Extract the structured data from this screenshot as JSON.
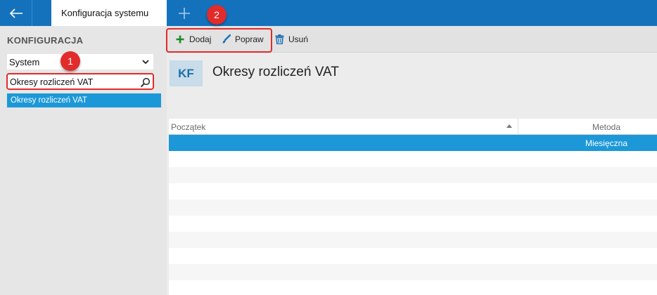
{
  "titlebar": {
    "active_tab_label": "Konfiguracja systemu"
  },
  "sidebar": {
    "heading": "KONFIGURACJA",
    "section_select_value": "System",
    "search_value": "Okresy rozliczeń VAT",
    "results": [
      "Okresy rozliczeń VAT"
    ]
  },
  "toolbar": {
    "add_label": "Dodaj",
    "edit_label": "Popraw",
    "delete_label": "Usuń"
  },
  "main": {
    "badge": "KF",
    "title": "Okresy rozliczeń VAT",
    "grid": {
      "columns": [
        "Początek",
        "Metoda"
      ],
      "rows": [
        {
          "start": "",
          "method": "Miesięczna"
        }
      ]
    }
  },
  "annotations": {
    "callout_1": "1",
    "callout_2": "2"
  },
  "colors": {
    "titlebar": "#1472bd",
    "selection": "#1c98d8",
    "add_icon": "#1e8a23",
    "edit_icon": "#1c6fb5",
    "delete_icon": "#1c6fb5",
    "annotation": "#e22b2b"
  },
  "icons": {
    "back": "arrow-left-icon",
    "new_tab": "plus-icon",
    "dropdown": "chevron-down-icon",
    "search": "search-icon",
    "add": "plus-icon",
    "edit": "brush-icon",
    "delete": "trash-icon"
  }
}
